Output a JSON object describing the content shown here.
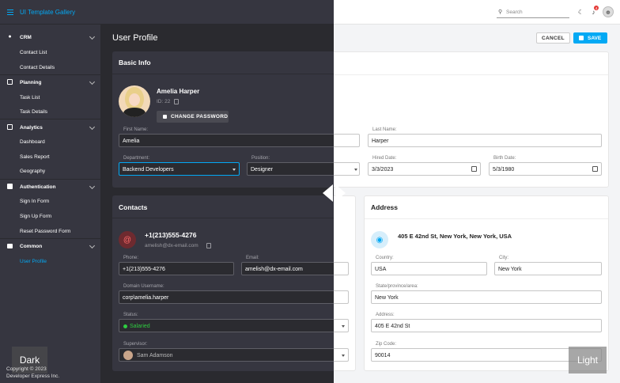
{
  "app": {
    "title": "UI Template Gallery"
  },
  "search": {
    "placeholder": "Search",
    "notification_count": "4"
  },
  "sidebar": {
    "groups": [
      {
        "label": "CRM",
        "icon": "user-icon",
        "items": [
          "Contact List",
          "Contact Details"
        ]
      },
      {
        "label": "Planning",
        "icon": "calendar-icon",
        "items": [
          "Task List",
          "Task Details"
        ]
      },
      {
        "label": "Analytics",
        "icon": "chart-icon",
        "items": [
          "Dashboard",
          "Sales Report",
          "Geography"
        ]
      },
      {
        "label": "Authentication",
        "icon": "id-card-icon",
        "items": [
          "Sign In Form",
          "Sign Up Form",
          "Reset Password Form"
        ]
      },
      {
        "label": "Common",
        "icon": "folder-icon",
        "items": [
          "User Profile"
        ]
      }
    ],
    "active_item": "User Profile"
  },
  "footer": {
    "line1": "Copyright © 2023",
    "line2": "Developer Express Inc."
  },
  "page": {
    "title": "User Profile",
    "cancel_label": "CANCEL",
    "save_label": "SAVE"
  },
  "basic_info": {
    "title": "Basic Info",
    "name": "Amelia Harper",
    "id_text": "ID: 22",
    "change_password_label": "CHANGE PASSWORD",
    "first_name_label": "First Name:",
    "first_name": "Amelia",
    "last_name_label": "Last Name:",
    "last_name": "Harper",
    "department_label": "Department:",
    "department": "Backend Developers",
    "position_label": "Position:",
    "position": "Designer",
    "hired_label": "Hired Date:",
    "hired": "3/3/2023",
    "birth_label": "Birth Date:",
    "birth": "5/3/1980"
  },
  "contacts": {
    "title": "Contacts",
    "phone_display": "+1(213)555-4276",
    "email_display": "amelish@dx-email.com",
    "phone_label": "Phone:",
    "phone": "+1(213)555-4276",
    "email_label": "Email:",
    "email": "amelish@dx-email.com",
    "domain_label": "Domain Username:",
    "domain": "corp\\amelia.harper",
    "status_label": "Status:",
    "status": "Salaried",
    "supervisor_label": "Supervisor:",
    "supervisor": "Sam Adamson"
  },
  "address": {
    "title": "Address",
    "display": "405 E 42nd St, New York, New York, USA",
    "country_label": "Country:",
    "country": "USA",
    "city_label": "City:",
    "city": "New York",
    "state_label": "State/province/area:",
    "state": "New York",
    "address_label": "Address:",
    "address": "405 E 42nd St",
    "zip_label": "Zip Code:",
    "zip": "90014"
  },
  "theme": {
    "dark_label": "Dark",
    "light_label": "Light"
  },
  "colors": {
    "accent": "#03a9f4",
    "dark_bg": "#2a2a2f",
    "dark_panel": "#363640",
    "status_green": "#2ecc40"
  }
}
